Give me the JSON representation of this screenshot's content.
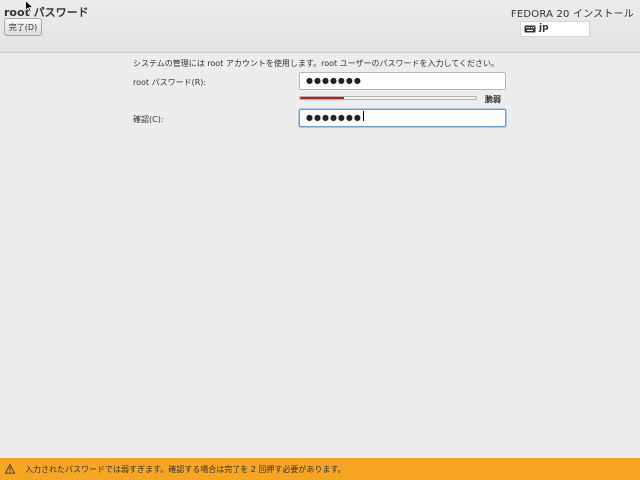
{
  "header": {
    "title": "root パスワード",
    "done_button": "完了(D)",
    "product": "FEDORA 20 インストール",
    "keyboard_layout": "jp"
  },
  "form": {
    "description": "システムの管理には root アカウントを使用します。root ユーザーのパスワードを入力してください。",
    "password_label": "root パスワード(R):",
    "password_value": "●●●●●●●",
    "strength": 0.25,
    "strength_label": "脆弱",
    "confirm_label": "確認(C):",
    "confirm_value": "●●●●●●●"
  },
  "warning": {
    "text": "入力されたパスワードでは弱すぎます。確認する場合は完了を 2 回押す必要があります。"
  },
  "colors": {
    "warning_bg": "#f6a623",
    "strength_fill": "#c11a1a",
    "focus_border": "#6f9fd8"
  },
  "icons": [
    "keyboard-icon",
    "warning-icon",
    "mouse-cursor-icon"
  ]
}
